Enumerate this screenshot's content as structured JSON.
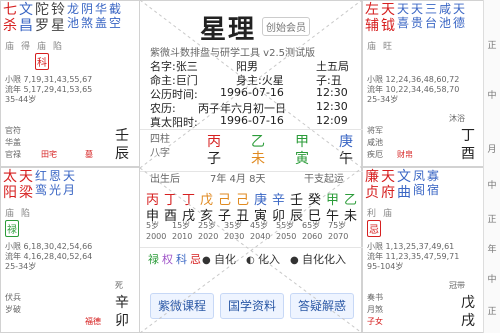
{
  "app": {
    "title": "星理",
    "badge": "创始会员",
    "subtitle": "紫微斗数排盘与研学工具 v2.5测试版"
  },
  "person": {
    "name": "名字:张三",
    "gender": "阳男",
    "bureau": "土五局",
    "ming_zhu": "命主:巨门",
    "shen_zhu": "身主:火星",
    "zishou": "子:丑",
    "gongli": "公历时间:",
    "gongli_val": "1996-07-16",
    "time1": "12:30",
    "nongli": "农历:",
    "nongli_val": "丙子年六月初一日",
    "time2": "12:30",
    "zhentai": "真太阳时:",
    "zhentai_val": "1996-07-16",
    "time3": "12:09"
  },
  "sizhu": {
    "label": "四柱",
    "bazi": "八字",
    "cols": [
      "丙",
      "乙",
      "甲",
      "庚"
    ],
    "cols2": [
      "子",
      "未",
      "寅",
      "午"
    ]
  },
  "dayun": {
    "label": "出生后",
    "first": "7年 4月 8天",
    "start": "干支起运",
    "rows": [
      "丙",
      "丁",
      "丁",
      "戊",
      "己",
      "己",
      "庚",
      "辛",
      "壬",
      "癸",
      "甲",
      "乙"
    ],
    "row2": [
      "申",
      "酉",
      "戌",
      "亥",
      "子",
      "丑",
      "寅",
      "卯",
      "辰",
      "巳",
      "午",
      "未"
    ],
    "ages": [
      "5岁",
      "15岁",
      "25岁",
      "35岁",
      "45岁",
      "55岁",
      "65岁",
      "75岁"
    ],
    "years": [
      "2000",
      "2010",
      "2020",
      "2030",
      "2040",
      "2050",
      "2060",
      "2070"
    ]
  },
  "legend": {
    "items": [
      "禄",
      "权",
      "科",
      "忌"
    ],
    "mode1": "自化",
    "mode2": "化入",
    "mode3": "自化化入"
  },
  "buttons": {
    "b1": "紫微课程",
    "b2": "国学资料",
    "b3": "答疑解惑"
  },
  "cells": {
    "tl": {
      "stars": [
        "七",
        "杀",
        "文",
        "昌",
        "陀",
        "罗",
        "铃",
        "星",
        "龙",
        "池",
        "阴",
        "煞",
        "华",
        "盖",
        "截",
        "空"
      ],
      "tags": [
        "庙",
        "得",
        "庙",
        "陷"
      ],
      "flag": "科",
      "kv": [
        "小限 7,19,31,43,55,67",
        "流年 5,17,29,41,53,65",
        "35-44岁"
      ],
      "bottom": [
        "官符",
        "华盖",
        "官禄",
        "田宅",
        "墓"
      ],
      "gz": [
        "壬",
        "辰"
      ]
    },
    "tr": {
      "stars": [
        "左",
        "辅",
        "天",
        "钺",
        "天",
        "喜",
        "天",
        "贵",
        "三",
        "台",
        "咸",
        "池",
        "天",
        "德"
      ],
      "tags": [
        "庙",
        "旺"
      ],
      "kv": [
        "小限 12,24,36,48,60,72",
        "流年 10,22,34,46,58,70",
        "25-34岁"
      ],
      "bottom": [
        "将军",
        "咸池",
        "疾厄",
        "财帛",
        "沐浴"
      ],
      "gz": [
        "丁",
        "酉"
      ]
    },
    "ml": {
      "stars": [
        "太",
        "阳",
        "天",
        "梁",
        "红",
        "鸾",
        "恩",
        "光",
        "天",
        "月"
      ],
      "tags": [
        "庙",
        "陷"
      ],
      "flag": "禄",
      "kv": [
        "小限 6,18,30,42,54,66",
        "流年 4,16,28,40,52,64",
        "25-34岁"
      ],
      "bottom": [
        "伏兵",
        "岁破",
        "福德",
        "辛",
        "死"
      ],
      "gz": [
        "辛",
        "卯"
      ]
    },
    "mr": {
      "stars": [
        "廉",
        "贞",
        "天",
        "府",
        "文",
        "曲",
        "凤",
        "阁",
        "寡",
        "宿"
      ],
      "tags": [
        "利",
        "庙"
      ],
      "flag": "忌",
      "kv": [
        "小限 1,13,25,37,49,61",
        "流年 11,23,35,47,59,71",
        "95-104岁"
      ],
      "bottom": [
        "奏书",
        "月煞",
        "子女",
        "冠带"
      ],
      "gz": [
        "戊",
        "戌"
      ]
    }
  },
  "side": {
    "items": [
      "正",
      "中",
      "月",
      "中",
      "正",
      "年",
      "中",
      "正"
    ]
  }
}
